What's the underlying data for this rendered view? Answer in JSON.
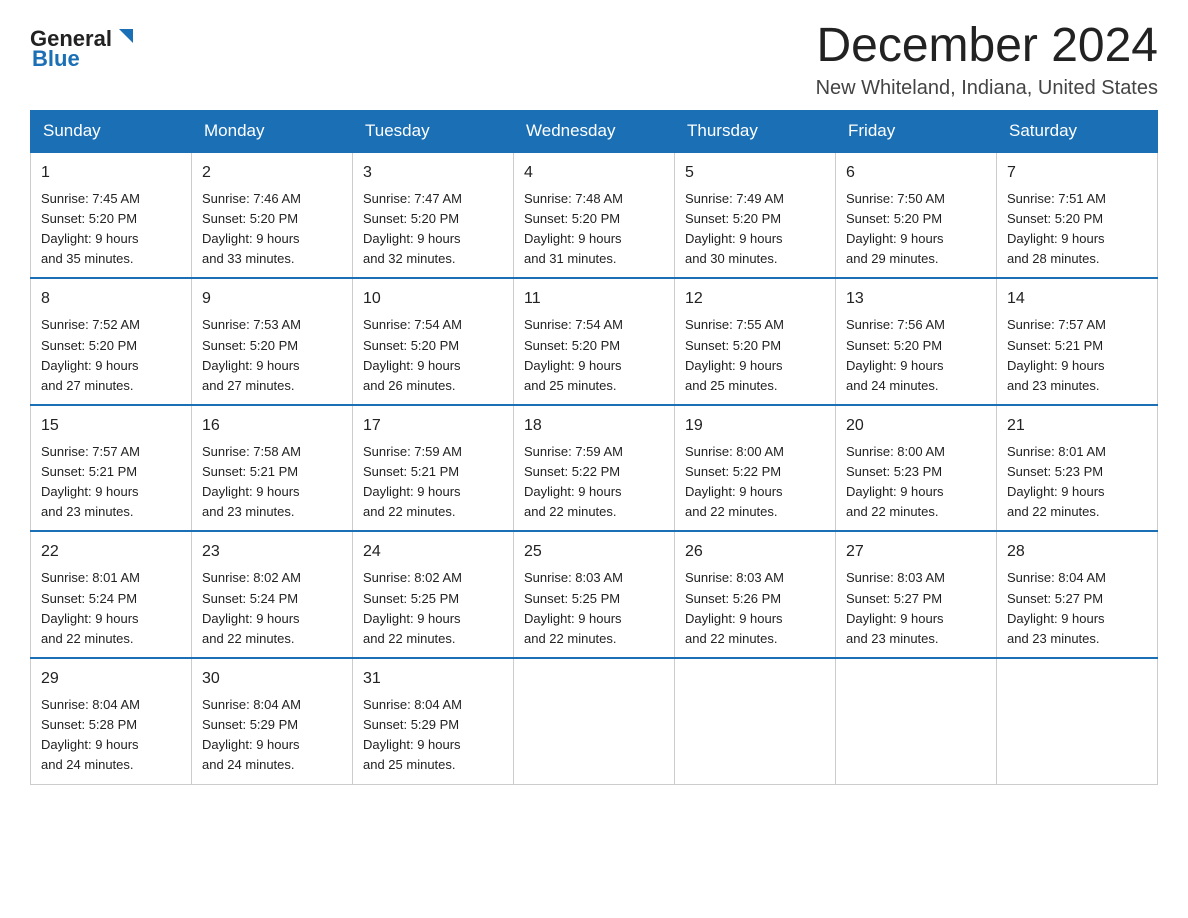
{
  "header": {
    "logo_general": "General",
    "logo_blue": "Blue",
    "month_title": "December 2024",
    "location": "New Whiteland, Indiana, United States"
  },
  "days_of_week": [
    "Sunday",
    "Monday",
    "Tuesday",
    "Wednesday",
    "Thursday",
    "Friday",
    "Saturday"
  ],
  "weeks": [
    [
      {
        "day": "1",
        "sunrise": "7:45 AM",
        "sunset": "5:20 PM",
        "daylight": "9 hours and 35 minutes."
      },
      {
        "day": "2",
        "sunrise": "7:46 AM",
        "sunset": "5:20 PM",
        "daylight": "9 hours and 33 minutes."
      },
      {
        "day": "3",
        "sunrise": "7:47 AM",
        "sunset": "5:20 PM",
        "daylight": "9 hours and 32 minutes."
      },
      {
        "day": "4",
        "sunrise": "7:48 AM",
        "sunset": "5:20 PM",
        "daylight": "9 hours and 31 minutes."
      },
      {
        "day": "5",
        "sunrise": "7:49 AM",
        "sunset": "5:20 PM",
        "daylight": "9 hours and 30 minutes."
      },
      {
        "day": "6",
        "sunrise": "7:50 AM",
        "sunset": "5:20 PM",
        "daylight": "9 hours and 29 minutes."
      },
      {
        "day": "7",
        "sunrise": "7:51 AM",
        "sunset": "5:20 PM",
        "daylight": "9 hours and 28 minutes."
      }
    ],
    [
      {
        "day": "8",
        "sunrise": "7:52 AM",
        "sunset": "5:20 PM",
        "daylight": "9 hours and 27 minutes."
      },
      {
        "day": "9",
        "sunrise": "7:53 AM",
        "sunset": "5:20 PM",
        "daylight": "9 hours and 27 minutes."
      },
      {
        "day": "10",
        "sunrise": "7:54 AM",
        "sunset": "5:20 PM",
        "daylight": "9 hours and 26 minutes."
      },
      {
        "day": "11",
        "sunrise": "7:54 AM",
        "sunset": "5:20 PM",
        "daylight": "9 hours and 25 minutes."
      },
      {
        "day": "12",
        "sunrise": "7:55 AM",
        "sunset": "5:20 PM",
        "daylight": "9 hours and 25 minutes."
      },
      {
        "day": "13",
        "sunrise": "7:56 AM",
        "sunset": "5:20 PM",
        "daylight": "9 hours and 24 minutes."
      },
      {
        "day": "14",
        "sunrise": "7:57 AM",
        "sunset": "5:21 PM",
        "daylight": "9 hours and 23 minutes."
      }
    ],
    [
      {
        "day": "15",
        "sunrise": "7:57 AM",
        "sunset": "5:21 PM",
        "daylight": "9 hours and 23 minutes."
      },
      {
        "day": "16",
        "sunrise": "7:58 AM",
        "sunset": "5:21 PM",
        "daylight": "9 hours and 23 minutes."
      },
      {
        "day": "17",
        "sunrise": "7:59 AM",
        "sunset": "5:21 PM",
        "daylight": "9 hours and 22 minutes."
      },
      {
        "day": "18",
        "sunrise": "7:59 AM",
        "sunset": "5:22 PM",
        "daylight": "9 hours and 22 minutes."
      },
      {
        "day": "19",
        "sunrise": "8:00 AM",
        "sunset": "5:22 PM",
        "daylight": "9 hours and 22 minutes."
      },
      {
        "day": "20",
        "sunrise": "8:00 AM",
        "sunset": "5:23 PM",
        "daylight": "9 hours and 22 minutes."
      },
      {
        "day": "21",
        "sunrise": "8:01 AM",
        "sunset": "5:23 PM",
        "daylight": "9 hours and 22 minutes."
      }
    ],
    [
      {
        "day": "22",
        "sunrise": "8:01 AM",
        "sunset": "5:24 PM",
        "daylight": "9 hours and 22 minutes."
      },
      {
        "day": "23",
        "sunrise": "8:02 AM",
        "sunset": "5:24 PM",
        "daylight": "9 hours and 22 minutes."
      },
      {
        "day": "24",
        "sunrise": "8:02 AM",
        "sunset": "5:25 PM",
        "daylight": "9 hours and 22 minutes."
      },
      {
        "day": "25",
        "sunrise": "8:03 AM",
        "sunset": "5:25 PM",
        "daylight": "9 hours and 22 minutes."
      },
      {
        "day": "26",
        "sunrise": "8:03 AM",
        "sunset": "5:26 PM",
        "daylight": "9 hours and 22 minutes."
      },
      {
        "day": "27",
        "sunrise": "8:03 AM",
        "sunset": "5:27 PM",
        "daylight": "9 hours and 23 minutes."
      },
      {
        "day": "28",
        "sunrise": "8:04 AM",
        "sunset": "5:27 PM",
        "daylight": "9 hours and 23 minutes."
      }
    ],
    [
      {
        "day": "29",
        "sunrise": "8:04 AM",
        "sunset": "5:28 PM",
        "daylight": "9 hours and 24 minutes."
      },
      {
        "day": "30",
        "sunrise": "8:04 AM",
        "sunset": "5:29 PM",
        "daylight": "9 hours and 24 minutes."
      },
      {
        "day": "31",
        "sunrise": "8:04 AM",
        "sunset": "5:29 PM",
        "daylight": "9 hours and 25 minutes."
      },
      null,
      null,
      null,
      null
    ]
  ],
  "labels": {
    "sunrise": "Sunrise:",
    "sunset": "Sunset:",
    "daylight": "Daylight:"
  }
}
